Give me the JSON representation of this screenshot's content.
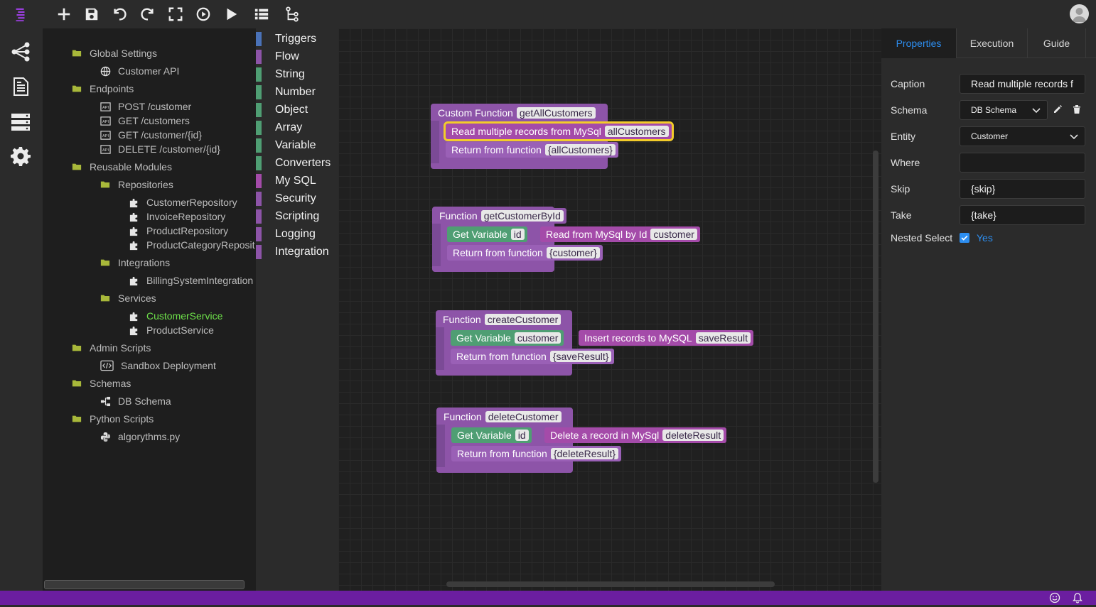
{
  "toolbar": {
    "icons": [
      "logo-icon",
      "add-icon",
      "save-icon",
      "undo-icon",
      "redo-icon",
      "fullscreen-icon",
      "debug-run-icon",
      "run-icon",
      "list-icon",
      "flow-tree-icon",
      "user-avatar-icon"
    ]
  },
  "sidebar": {
    "icons": [
      "share-nodes-icon",
      "document-icon",
      "server-icon",
      "settings-icon"
    ]
  },
  "tree": {
    "global_settings": "Global Settings",
    "customer_api": "Customer API",
    "endpoints": "Endpoints",
    "post_customer": "POST /customer",
    "get_customers": "GET /customers",
    "get_customer_id": "GET /customer/{id}",
    "delete_customer_id": "DELETE /customer/{id}",
    "reusable_modules": "Reusable Modules",
    "repositories": "Repositories",
    "customer_repository": "CustomerRepository",
    "invoice_repository": "InvoiceRepository",
    "product_repository": "ProductRepository",
    "product_category_repository": "ProductCategoryReposit",
    "integrations": "Integrations",
    "billing_system_integration": "BillingSystemIntegration",
    "services": "Services",
    "customer_service": "CustomerService",
    "product_service": "ProductService",
    "admin_scripts": "Admin Scripts",
    "sandbox_deployment": "Sandbox Deployment",
    "schemas": "Schemas",
    "db_schema": "DB Schema",
    "python_scripts": "Python Scripts",
    "algorythms": "algorythms.py"
  },
  "categories": [
    {
      "label": "Triggers",
      "color": "#4a72b8"
    },
    {
      "label": "Flow",
      "color": "#8d54a8"
    },
    {
      "label": "String",
      "color": "#4f9e73"
    },
    {
      "label": "Number",
      "color": "#4f9e73"
    },
    {
      "label": "Object",
      "color": "#4f9e73"
    },
    {
      "label": "Array",
      "color": "#4f9e73"
    },
    {
      "label": "Variable",
      "color": "#4f9e73"
    },
    {
      "label": "Converters",
      "color": "#4f9e73"
    },
    {
      "label": "My SQL",
      "color": "#a44ba9"
    },
    {
      "label": "Security",
      "color": "#8d54a8"
    },
    {
      "label": "Scripting",
      "color": "#8d54a8"
    },
    {
      "label": "Logging",
      "color": "#8d54a8"
    },
    {
      "label": "Integration",
      "color": "#8d54a8"
    }
  ],
  "blocks": {
    "fn1": {
      "kw": "Custom Function",
      "name": "getAllCustomers",
      "read_label": "Read multiple records from MySql",
      "read_var": "allCustomers",
      "ret_label": "Return from function",
      "ret_val": "{allCustomers}"
    },
    "fn2": {
      "kw": "Function",
      "name": "getCustomerById",
      "getvar_label": "Get Variable",
      "getvar_val": "id",
      "read_label": "Read from MySql by Id",
      "read_var": "customer",
      "ret_label": "Return from function",
      "ret_val": "{customer}"
    },
    "fn3": {
      "kw": "Function",
      "name": "createCustomer",
      "getvar_label": "Get Variable",
      "getvar_val": "customer",
      "insert_label": "Insert records to MySQL",
      "insert_var": "saveResult",
      "ret_label": "Return from function",
      "ret_val": "{saveResult}"
    },
    "fn4": {
      "kw": "Function",
      "name": "deleteCustomer",
      "getvar_label": "Get Variable",
      "getvar_val": "id",
      "delete_label": "Delete a record in MySql",
      "delete_var": "deleteResult",
      "ret_label": "Return from function",
      "ret_val": "{deleteResult}"
    }
  },
  "properties": {
    "tabs": [
      "Properties",
      "Execution",
      "Guide"
    ],
    "active_tab": "Properties",
    "caption_label": "Caption",
    "caption_value": "Read multiple records f",
    "schema_label": "Schema",
    "schema_value": "DB Schema",
    "entity_label": "Entity",
    "entity_value": "Customer",
    "where_label": "Where",
    "where_value": "",
    "skip_label": "Skip",
    "skip_value": "{skip}",
    "take_label": "Take",
    "take_value": "{take}",
    "nested_label": "Nested Select",
    "nested_value": "Yes",
    "nested_checked": true
  },
  "statusbar": {
    "icons": [
      "smiley-icon",
      "bell-icon"
    ]
  }
}
